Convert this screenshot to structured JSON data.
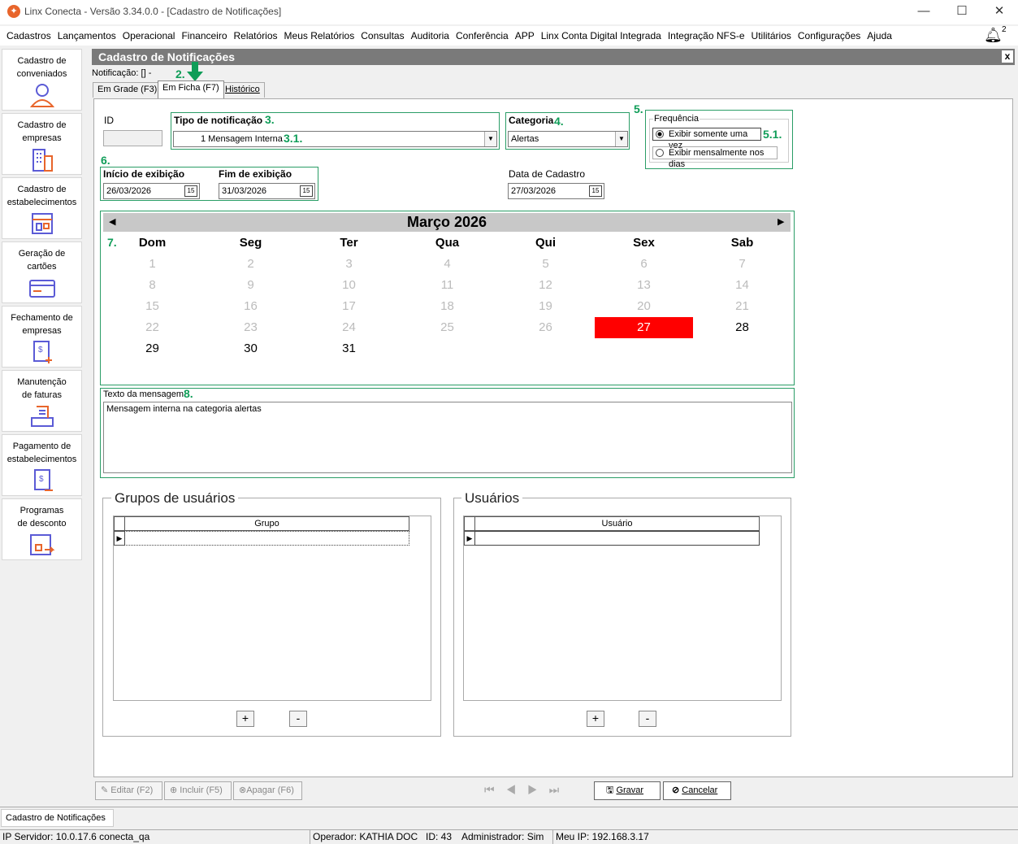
{
  "window": {
    "title": "Linx Conecta - Versão 3.34.0.0 - [Cadastro de Notificações]",
    "app_icon": "linx-logo-icon",
    "controls": [
      "minimize-icon",
      "maximize-icon",
      "close-icon"
    ]
  },
  "menu": [
    "Cadastros",
    "Lançamentos",
    "Operacional",
    "Financeiro",
    "Relatórios",
    "Meus Relatórios",
    "Consultas",
    "Auditoria",
    "Conferência",
    "APP",
    "Linx Conta Digital Integrada",
    "Integração NFS-e",
    "Utilitários",
    "Configurações",
    "Ajuda"
  ],
  "notifications": {
    "icon": "bell-icon",
    "count": "2"
  },
  "sidebar": [
    {
      "line1": "Cadastro de",
      "line2": "conveniados",
      "icon": "person-icon"
    },
    {
      "line1": "Cadastro de",
      "line2": "empresas",
      "icon": "building-icon"
    },
    {
      "line1": "Cadastro de",
      "line2": "estabelecimentos",
      "icon": "store-icon"
    },
    {
      "line1": "Geração de",
      "line2": "cartões",
      "icon": "card-icon"
    },
    {
      "line1": "Fechamento de",
      "line2": "empresas",
      "icon": "invoice-icon"
    },
    {
      "line1": "Manutenção",
      "line2": "de faturas",
      "icon": "tray-icon"
    },
    {
      "line1": "Pagamento de",
      "line2": "estabelecimentos",
      "icon": "payment-doc-icon"
    },
    {
      "line1": "Programas",
      "line2": "de desconto",
      "icon": "discount-icon"
    }
  ],
  "panel": {
    "title": "Cadastro de Notificações",
    "close": "x",
    "notificacao_label": "Notificação: [] -"
  },
  "tabs": [
    "Em Grade (F3)",
    "Em Ficha (F7)",
    "Histórico"
  ],
  "annotations": {
    "n2": "2.",
    "n3": "3.",
    "n31": "3.1.",
    "n4": "4.",
    "n5": "5.",
    "n51": "5.1.",
    "n6": "6.",
    "n7": "7.",
    "n8": "8."
  },
  "form": {
    "id_label": "ID",
    "id_value": "",
    "tipo_label": "Tipo de notificação",
    "tipo_value": "1  Mensagem Interna",
    "categoria_label": "Categoria",
    "categoria_value": "Alertas",
    "frequencia_label": "Frequência",
    "freq_option1": "Exibir somente uma vez",
    "freq_option2": "Exibir mensalmente nos dias",
    "freq_selected": 1,
    "inicio_label": "Início de exibição",
    "inicio_value": "26/03/2026",
    "fim_label": "Fim de exibição",
    "fim_value": "31/03/2026",
    "data_cadastro_label": "Data de Cadastro",
    "data_cadastro_value": "27/03/2026",
    "texto_label": "Texto da mensagem",
    "texto_value": "Mensagem interna na categoria alertas"
  },
  "calendar": {
    "title": "Março 2026",
    "days": [
      "Dom",
      "Seg",
      "Ter",
      "Qua",
      "Qui",
      "Sex",
      "Sab"
    ],
    "weeks": [
      [
        "1",
        "2",
        "3",
        "4",
        "5",
        "6",
        "7"
      ],
      [
        "8",
        "9",
        "10",
        "11",
        "12",
        "13",
        "14"
      ],
      [
        "15",
        "16",
        "17",
        "18",
        "19",
        "20",
        "21"
      ],
      [
        "22",
        "23",
        "24",
        "25",
        "26",
        "27",
        "28"
      ],
      [
        "29",
        "30",
        "31",
        "",
        "",
        "",
        ""
      ]
    ],
    "selected": "27",
    "active_from": "27"
  },
  "grupos": {
    "title": "Grupos de usuários",
    "column": "Grupo",
    "add": "+",
    "remove": "-"
  },
  "usuarios": {
    "title": "Usuários",
    "column": "Usuário",
    "add": "+",
    "remove": "-"
  },
  "buttons": {
    "editar": "Editar (F2)",
    "incluir": "Incluir (F5)",
    "apagar": "Apagar (F6)",
    "gravar": "Gravar",
    "cancelar": "Cancelar"
  },
  "bottom_tab": "Cadastro de Notificações",
  "status": {
    "servidor": "IP Servidor: 10.0.17.6 conecta_qa",
    "operador": "Operador: KATHIA DOC",
    "id": "ID: 43",
    "admin": "Administrador: Sim",
    "ip": "Meu IP: 192.168.3.17"
  }
}
